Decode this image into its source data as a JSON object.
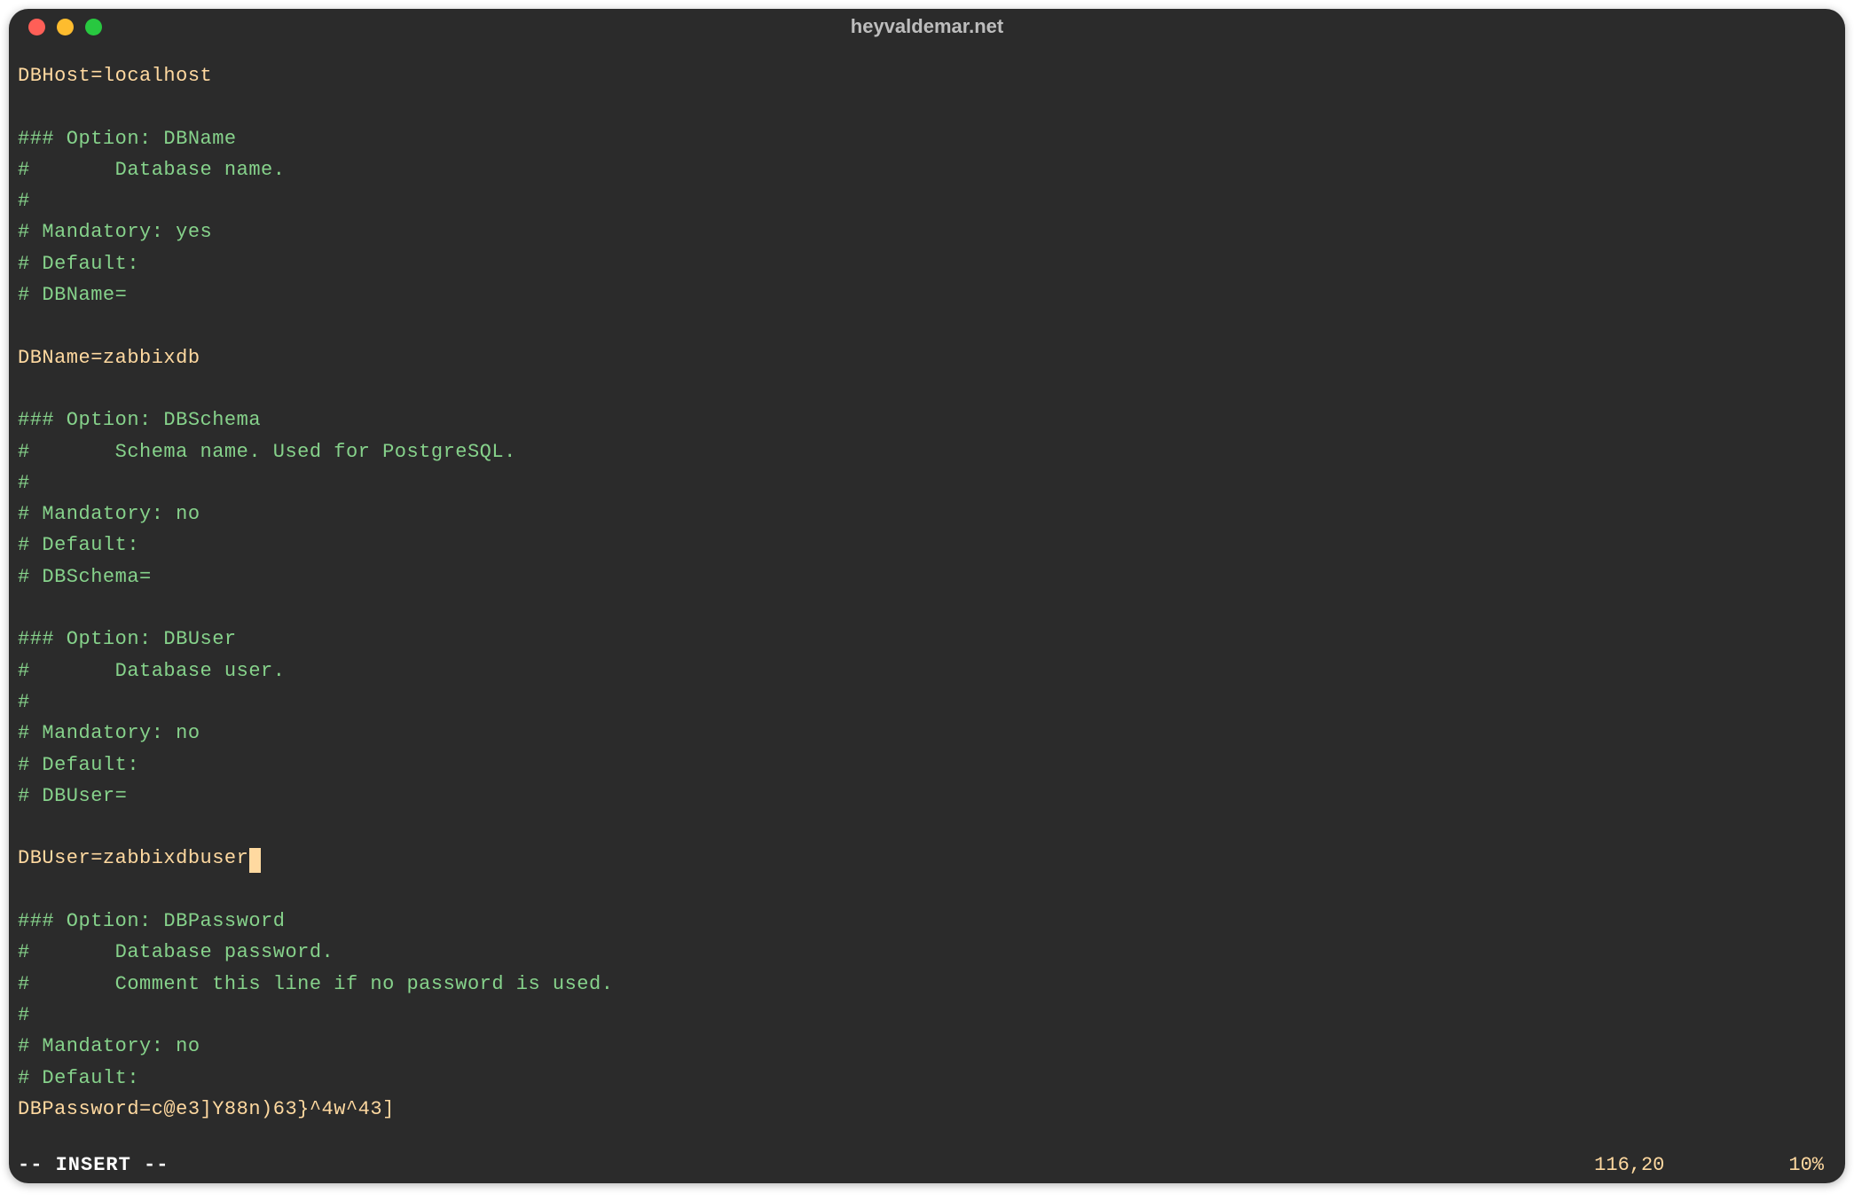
{
  "window": {
    "title": "heyvaldemar.net"
  },
  "editor": {
    "lines": [
      {
        "text": "DBHost=localhost",
        "cls": "kv"
      },
      {
        "text": "",
        "cls": "kv"
      },
      {
        "text": "### Option: DBName",
        "cls": "comment"
      },
      {
        "text": "#       Database name.",
        "cls": "comment"
      },
      {
        "text": "#",
        "cls": "comment"
      },
      {
        "text": "# Mandatory: yes",
        "cls": "comment"
      },
      {
        "text": "# Default:",
        "cls": "comment"
      },
      {
        "text": "# DBName=",
        "cls": "comment"
      },
      {
        "text": "",
        "cls": "kv"
      },
      {
        "text": "DBName=zabbixdb",
        "cls": "kv"
      },
      {
        "text": "",
        "cls": "kv"
      },
      {
        "text": "### Option: DBSchema",
        "cls": "comment"
      },
      {
        "text": "#       Schema name. Used for PostgreSQL.",
        "cls": "comment"
      },
      {
        "text": "#",
        "cls": "comment"
      },
      {
        "text": "# Mandatory: no",
        "cls": "comment"
      },
      {
        "text": "# Default:",
        "cls": "comment"
      },
      {
        "text": "# DBSchema=",
        "cls": "comment"
      },
      {
        "text": "",
        "cls": "kv"
      },
      {
        "text": "### Option: DBUser",
        "cls": "comment"
      },
      {
        "text": "#       Database user.",
        "cls": "comment"
      },
      {
        "text": "#",
        "cls": "comment"
      },
      {
        "text": "# Mandatory: no",
        "cls": "comment"
      },
      {
        "text": "# Default:",
        "cls": "comment"
      },
      {
        "text": "# DBUser=",
        "cls": "comment"
      },
      {
        "text": "",
        "cls": "kv"
      },
      {
        "text": "DBUser=zabbixdbuser",
        "cls": "kv",
        "cursor": true
      },
      {
        "text": "",
        "cls": "kv"
      },
      {
        "text": "### Option: DBPassword",
        "cls": "comment"
      },
      {
        "text": "#       Database password.",
        "cls": "comment"
      },
      {
        "text": "#       Comment this line if no password is used.",
        "cls": "comment"
      },
      {
        "text": "#",
        "cls": "comment"
      },
      {
        "text": "# Mandatory: no",
        "cls": "comment"
      },
      {
        "text": "# Default:",
        "cls": "comment"
      },
      {
        "text": "DBPassword=c@e3]Y88n)63}^4w^43]",
        "cls": "kv"
      }
    ]
  },
  "status": {
    "mode": "-- INSERT --",
    "position": "116,20",
    "percent": "10%"
  }
}
